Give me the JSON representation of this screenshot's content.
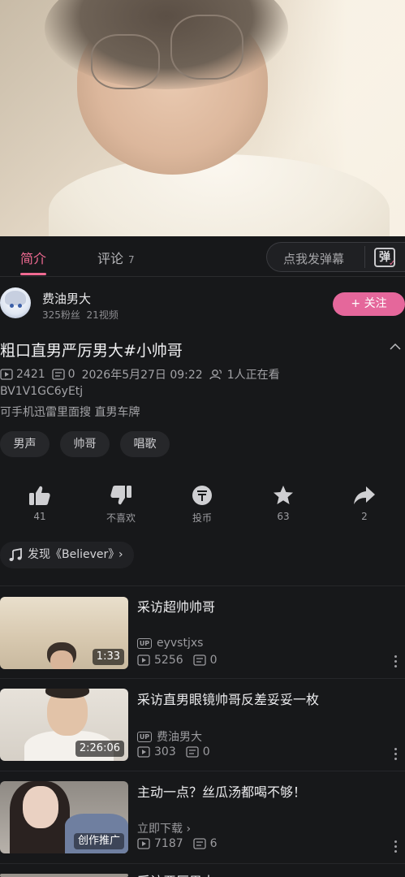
{
  "tabs": [
    {
      "label": "简介"
    },
    {
      "label": "评论",
      "count": "7"
    }
  ],
  "danmu": {
    "placeholder": "点我发弹幕",
    "icon_text": "弹"
  },
  "uploader": {
    "name": "费油男大",
    "followers": "325粉丝",
    "videos": "21视频",
    "follow_label": "+ 关注"
  },
  "video": {
    "title": "粗口直男严厉男大#小帅哥",
    "plays": "2421",
    "danmaku": "0",
    "date": "2026年5月27日 09:22",
    "watching": "1人正在看",
    "bvid": "BV1V1GC6yEtj",
    "description": "可手机迅雷里面搜 直男车牌"
  },
  "tags": [
    "男声",
    "帅哥",
    "唱歌"
  ],
  "actions": [
    {
      "icon": "thumb-up-icon",
      "label": "41"
    },
    {
      "icon": "thumb-down-icon",
      "label": "不喜欢"
    },
    {
      "icon": "coin-icon",
      "label": "投币"
    },
    {
      "icon": "star-icon",
      "label": "63"
    },
    {
      "icon": "share-icon",
      "label": "2"
    }
  ],
  "music": {
    "label": "发现《Believer》"
  },
  "related": [
    {
      "title": "采访超帅帅哥",
      "up": "eyvstjxs",
      "plays": "5256",
      "danmaku": "0",
      "duration": "1:33"
    },
    {
      "title": "采访直男眼镜帅哥反差妥妥一枚",
      "up": "费油男大",
      "plays": "303",
      "danmaku": "0",
      "duration": "2:26:06"
    },
    {
      "title": "主动一点？丝瓜汤都喝不够！",
      "up": "立即下载 ›",
      "plays": "7187",
      "danmaku": "6",
      "duration": "创作推广"
    },
    {
      "title": "采访严厉男大"
    }
  ],
  "colors": {
    "accent": "#f06a92",
    "follow_bg": "#e5679b",
    "background": "#17181a"
  }
}
